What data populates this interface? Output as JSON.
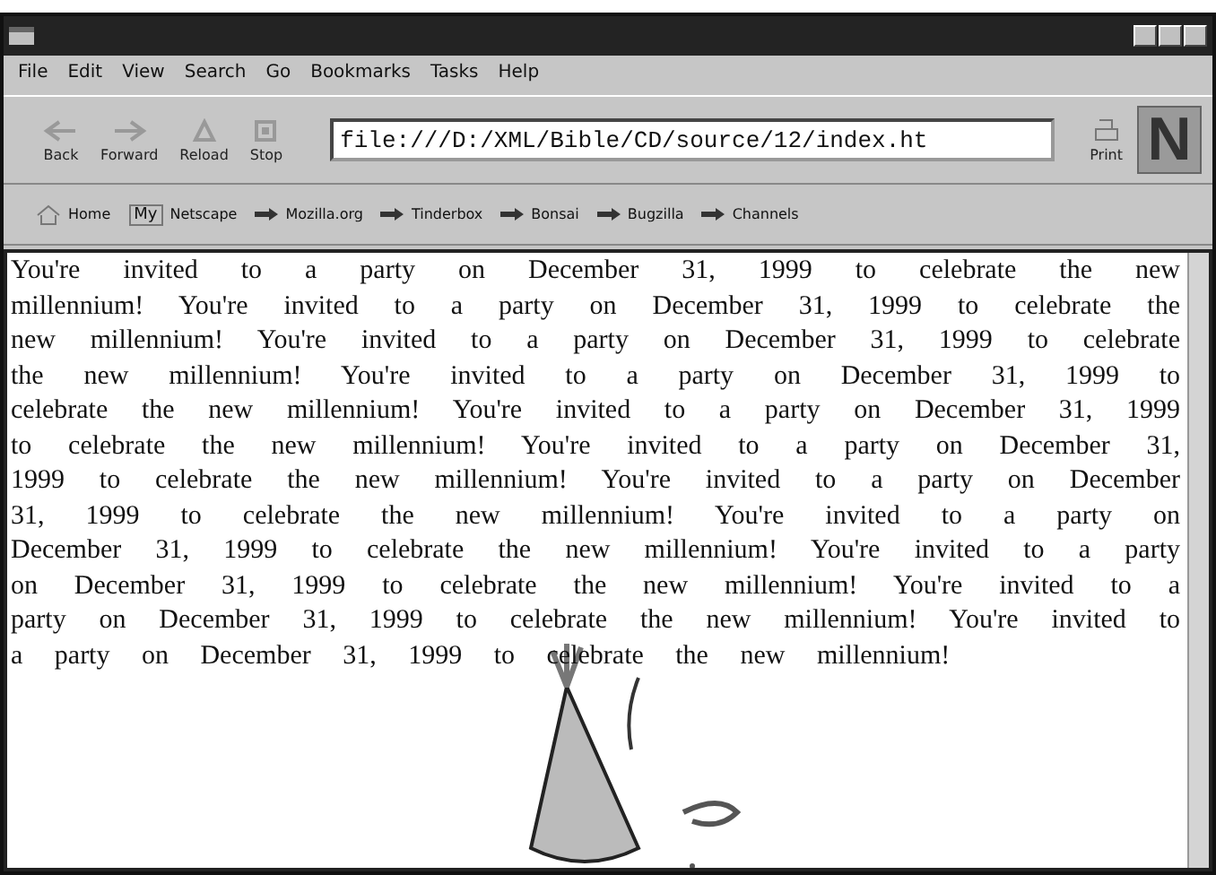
{
  "menu": [
    "File",
    "Edit",
    "View",
    "Search",
    "Go",
    "Bookmarks",
    "Tasks",
    "Help"
  ],
  "nav_buttons": [
    {
      "kind": "back",
      "label": "Back"
    },
    {
      "kind": "forward",
      "label": "Forward"
    },
    {
      "kind": "reload",
      "label": "Reload"
    },
    {
      "kind": "stop",
      "label": "Stop"
    }
  ],
  "address": "file:///D:/XML/Bible/CD/source/12/index.ht",
  "print_button": "Print",
  "logo": "N",
  "personal_toolbar": [
    {
      "kind": "home",
      "label": "Home"
    },
    {
      "kind": "my",
      "icon_text": "My",
      "label": "Netscape"
    },
    {
      "kind": "link",
      "label": "Mozilla.org"
    },
    {
      "kind": "link",
      "label": "Tinderbox"
    },
    {
      "kind": "link",
      "label": "Bonsai"
    },
    {
      "kind": "link",
      "label": "Bugzilla"
    },
    {
      "kind": "link",
      "label": "Channels"
    }
  ],
  "content": {
    "paragraph": "You're invited to a party on December 31, 1999 to celebrate the new millennium! You're invited to a party on December 31, 1999 to celebrate the new millennium! You're invited to a party on December 31, 1999 to celebrate the new millennium! You're invited to a party on December 31, 1999 to celebrate the new millennium! You're invited to a party on December 31, 1999 to celebrate the new millennium! You're invited to a party on December 31, 1999 to celebrate the new millennium! You're invited to a party on December 31, 1999 to celebrate the new millennium! You're invited to a party on December 31, 1999 to celebrate the new millennium! You're invited to a party on December 31, 1999 to celebrate the new millennium! You're invited to a party on December 31, 1999 to celebrate the new millennium! You're invited to a party on December 31, 1999 to celebrate the new millennium!"
  }
}
